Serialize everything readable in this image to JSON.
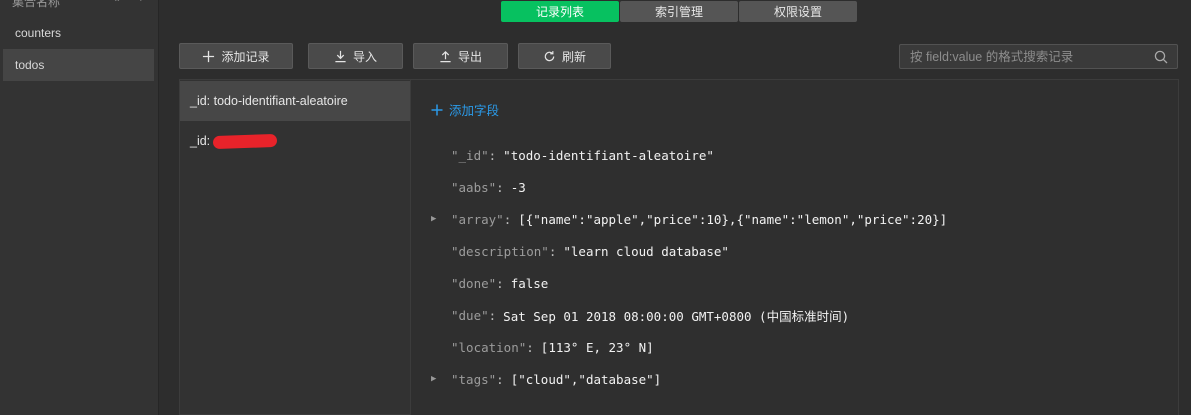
{
  "sidebar": {
    "header_label": "集合名称",
    "collections": [
      {
        "label": "counters",
        "active": false
      },
      {
        "label": "todos",
        "active": true
      }
    ]
  },
  "tabs": [
    {
      "label": "记录列表",
      "active": true
    },
    {
      "label": "索引管理",
      "active": false
    },
    {
      "label": "权限设置",
      "active": false
    }
  ],
  "toolbar": {
    "add_record": "添加记录",
    "import": "导入",
    "export": "导出",
    "refresh": "刷新",
    "search_placeholder": "按 field:value 的格式搜索记录"
  },
  "records": [
    {
      "label": "_id: todo-identifiant-aleatoire",
      "active": true
    },
    {
      "label": "_id:",
      "active": false,
      "redacted": true
    }
  ],
  "detail": {
    "add_field": "添加字段",
    "fields": [
      {
        "key": "\"_id\"",
        "value": "\"todo-identifiant-aleatoire\"",
        "expandable": false
      },
      {
        "key": "\"aabs\"",
        "value": "-3",
        "expandable": false
      },
      {
        "key": "\"array\"",
        "value": "[{\"name\":\"apple\",\"price\":10},{\"name\":\"lemon\",\"price\":20}]",
        "expandable": true
      },
      {
        "key": "\"description\"",
        "value": "\"learn cloud database\"",
        "expandable": false
      },
      {
        "key": "\"done\"",
        "value": "false",
        "expandable": false
      },
      {
        "key": "\"due\"",
        "value": "Sat Sep 01 2018 08:00:00 GMT+0800 (中国标准时间)",
        "expandable": false
      },
      {
        "key": "\"location\"",
        "value": "[113° E, 23° N]",
        "expandable": false
      },
      {
        "key": "\"tags\"",
        "value": "[\"cloud\",\"database\"]",
        "expandable": true
      }
    ]
  },
  "colors": {
    "accent_green": "#07c160",
    "link_blue": "#2b9ae8",
    "redaction_red": "#e8232a"
  }
}
